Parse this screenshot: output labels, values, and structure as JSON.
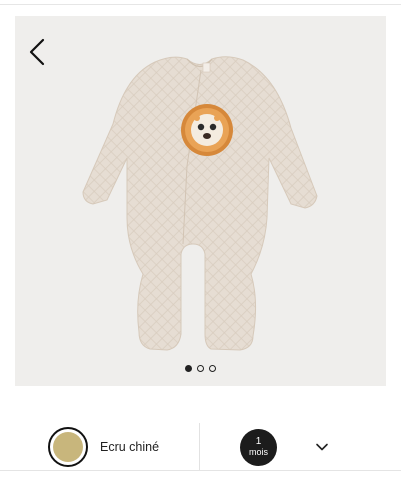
{
  "gallery": {
    "image_alt": "Ecru chiné baby sleepsuit with lion patch",
    "slide_count": 3,
    "active_slide": 0
  },
  "variant": {
    "color_name": "Ecru chiné",
    "color_swatch": "#c8b67c",
    "size_value": "1",
    "size_unit": "mois"
  },
  "colors": {
    "background": "#efeeec",
    "garment": "#e6ddd3",
    "dark": "#1c1c1c"
  },
  "icons": {
    "back": "chevron-left-icon",
    "size_dropdown": "chevron-down-icon"
  }
}
